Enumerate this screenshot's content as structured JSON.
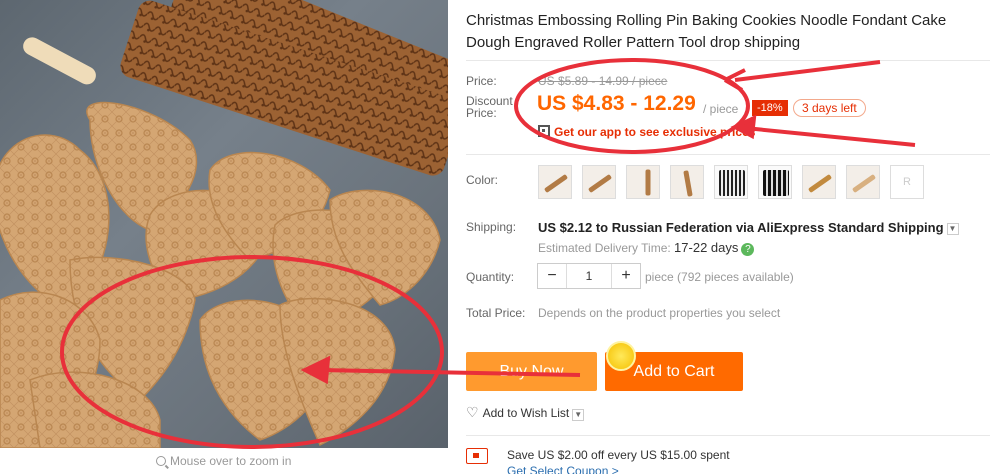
{
  "product": {
    "title": "Christmas Embossing Rolling Pin Baking Cookies Noodle Fondant Cake Dough Engraved Roller Pattern Tool drop shipping"
  },
  "image": {
    "zoom_hint": "Mouse over to zoom in"
  },
  "price": {
    "label": "Price:",
    "original": "US $5.89 - 14.99 / piece",
    "discount_label": "Discount Price:",
    "discount": "US $4.83 - 12.29",
    "per_unit": "/ piece",
    "discount_pct": "-18%",
    "time_left": "3 days left",
    "app_promo": "Get our app to see exclusive prices"
  },
  "color": {
    "label": "Color:",
    "swatches": [
      "swatch-1",
      "swatch-2",
      "swatch-3",
      "swatch-4",
      "swatch-5",
      "swatch-6",
      "swatch-7",
      "swatch-8"
    ],
    "more": "R"
  },
  "shipping": {
    "label": "Shipping:",
    "main": "US $2.12 to Russian Federation via AliExpress Standard Shipping",
    "delivery_prefix": "Estimated Delivery Time:",
    "delivery_days": "17-22 days"
  },
  "quantity": {
    "label": "Quantity:",
    "value": "1",
    "minus": "−",
    "plus": "+",
    "info": "piece (792 pieces available)"
  },
  "total": {
    "label": "Total Price:",
    "note": "Depends on the product properties you select"
  },
  "buttons": {
    "buy_now": "Buy Now",
    "add_to_cart": "Add to Cart"
  },
  "wishlist": {
    "label": "Add to Wish List"
  },
  "coupon": {
    "text": "Save US $2.00 off every US $15.00 spent",
    "link": "Get Select Coupon >"
  },
  "colors": {
    "accent": "#ff6a00",
    "discount_red": "#e62e04",
    "buy_now": "#ff9a2e",
    "annotation": "#e8303a"
  }
}
